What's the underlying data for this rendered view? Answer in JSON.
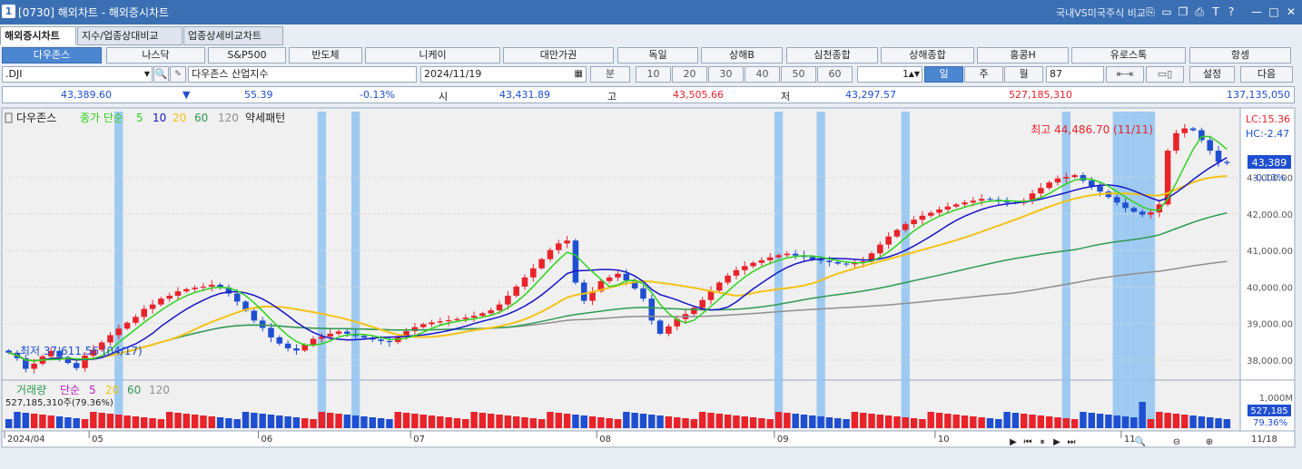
{
  "window": {
    "code": "[0730]",
    "title": "해외차트 - 해외증시차트",
    "right_label": "국내VS미국주식 비교",
    "app_icon": "1"
  },
  "tabs": [
    {
      "label": "해외증시차트",
      "active": true
    },
    {
      "label": "지수/업종상대비교",
      "active": false
    },
    {
      "label": "업종상세비교차트",
      "active": false
    }
  ],
  "symbols": [
    "다우존스",
    "나스닥",
    "S&P500",
    "반도체",
    "니케이",
    "대만가권",
    "독일",
    "상해B",
    "심천종합",
    "상해종합",
    "홍콩H",
    "유로스톡",
    "항셍"
  ],
  "active_symbol": 0,
  "controls": {
    "ticker": ".DJI",
    "name": "다우존스 산업지수",
    "date": "2024/11/19",
    "minute_label": "분",
    "minute_options": [
      "10",
      "20",
      "30",
      "40",
      "50",
      "60"
    ],
    "count_value": "1",
    "period_tabs": [
      "일",
      "주",
      "월"
    ],
    "active_period": 0,
    "bars_value": "87",
    "settings_label": "설정",
    "next_label": "다음"
  },
  "quote": {
    "price": "43,389.60",
    "change": "55.39",
    "change_pct": "-0.13%",
    "open_label": "시",
    "open": "43,431.89",
    "high_label": "고",
    "high": "43,505.66",
    "low_label": "저",
    "low": "43,297.57",
    "volume": "527,185,310",
    "amount": "137,135,050"
  },
  "colors": {
    "up": "#e8232a",
    "down": "#1f4fd1",
    "ma5": "#2fd21f",
    "ma10": "#1515c8",
    "ma20": "#f3c316",
    "ma60": "#2e9b52",
    "ma120": "#8f8f8f",
    "highlight": "#8fc3f2",
    "bg": "#f0f0f0"
  },
  "chart_data": {
    "type": "candlestick",
    "title": "다우존스",
    "legend": {
      "prefix": "종가 단순",
      "periods": [
        "5",
        "10",
        "20",
        "60",
        "120"
      ],
      "pattern": "약세패턴"
    },
    "ylim": [
      37500,
      44800
    ],
    "yticks": [
      38000,
      39000,
      40000,
      41000,
      42000,
      43000
    ],
    "ytick_labels": [
      "38,000.00",
      "39,000.00",
      "40,000.00",
      "41,000.00",
      "42,000.00",
      "43,000.00"
    ],
    "x_month_labels": [
      {
        "label": "2024/04",
        "index": 0
      },
      {
        "label": "05",
        "index": 10
      },
      {
        "label": "06",
        "index": 31
      },
      {
        "label": "07",
        "index": 50
      },
      {
        "label": "08",
        "index": 72
      },
      {
        "label": "09",
        "index": 94
      },
      {
        "label": "10",
        "index": 114
      },
      {
        "label": "11",
        "index": 137
      }
    ],
    "last_date_label": "11/18",
    "closes": [
      38200,
      38050,
      37760,
      37900,
      38100,
      38250,
      38080,
      37920,
      37780,
      38120,
      38280,
      38480,
      38680,
      38860,
      39020,
      39180,
      39400,
      39520,
      39680,
      39760,
      39880,
      39940,
      39980,
      40010,
      40060,
      39980,
      39820,
      39600,
      39350,
      39080,
      38880,
      38620,
      38450,
      38320,
      38260,
      38420,
      38580,
      38640,
      38720,
      38780,
      38720,
      38660,
      38610,
      38560,
      38520,
      38490,
      38640,
      38790,
      38900,
      38980,
      39030,
      39060,
      39090,
      39120,
      39160,
      39210,
      39280,
      39360,
      39520,
      39760,
      40010,
      40260,
      40510,
      40760,
      41010,
      41190,
      41270,
      40120,
      39620,
      39880,
      40160,
      40260,
      40360,
      40180,
      39960,
      39680,
      39080,
      38720,
      38920,
      39120,
      39260,
      39430,
      39640,
      39900,
      40120,
      40310,
      40460,
      40570,
      40660,
      40730,
      40810,
      40870,
      40910,
      40860,
      40820,
      40760,
      40720,
      40680,
      40640,
      40620,
      40660,
      40700,
      40920,
      41160,
      41380,
      41560,
      41720,
      41840,
      41950,
      42030,
      42120,
      42200,
      42260,
      42310,
      42360,
      42410,
      42390,
      42340,
      42310,
      42300,
      42360,
      42560,
      42710,
      42860,
      42970,
      43010,
      43060,
      42910,
      42760,
      42610,
      42460,
      42310,
      42160,
      42060,
      41980,
      42040,
      42260,
      43730,
      44210,
      44340,
      44290,
      44020,
      43730,
      43420,
      43389
    ],
    "volume_max": 1000000000,
    "volume_ticks": [
      "1,000M"
    ],
    "volume_legend": {
      "label": "거래량",
      "prefix": "단순",
      "periods": [
        "5",
        "20",
        "60",
        "120"
      ],
      "last_value": "527,185,310주(79.36%)"
    },
    "last_price_label": "43,389",
    "last_change_pct": "-0.13%",
    "last_volume_label": "527,185",
    "last_volume_pct": "79.36%",
    "lc_label": "LC:15.36",
    "hc_label": "HC:-2.47",
    "high_annotation": "최고 44,486.70 (11/11)",
    "low_annotation": "최저 37,611.56 (04/17)",
    "highlight_index": [
      13,
      37,
      41,
      91,
      96,
      106,
      125,
      131,
      132,
      133,
      134,
      135,
      163,
      168
    ]
  }
}
